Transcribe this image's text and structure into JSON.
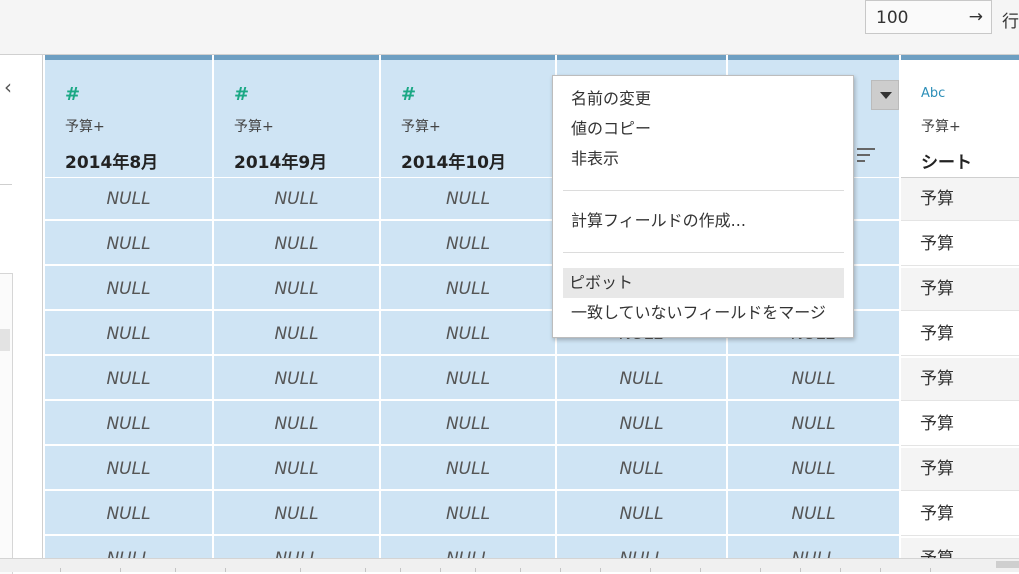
{
  "toolbar": {
    "rows_value": "100",
    "rows_arrow": "→",
    "rows_label": "行"
  },
  "left_panel": {
    "collapse_glyph": "‹"
  },
  "columns": [
    {
      "type_icon": "#",
      "source": "予算+",
      "name": "2014年8月"
    },
    {
      "type_icon": "#",
      "source": "予算+",
      "name": "2014年9月"
    },
    {
      "type_icon": "#",
      "source": "予算+",
      "name": "2014年10月"
    },
    {
      "type_icon": "#",
      "source": "",
      "name": ""
    },
    {
      "type_icon": "#",
      "source": "",
      "name": ""
    },
    {
      "type_icon": "Abc",
      "source": "予算+",
      "name": "シート"
    }
  ],
  "null_text": "NULL",
  "sheet_value": "予算",
  "context_menu": {
    "items": [
      "名前の変更",
      "値のコピー",
      "非表示",
      "計算フィールドの作成...",
      "ピボット",
      "一致していないフィールドをマージ"
    ],
    "highlighted_index": 4
  },
  "colors": {
    "selected_column": "#cfe4f4",
    "header_accent": "#6e9fc2",
    "number_icon": "#1aa884",
    "string_icon": "#2d8fb8"
  }
}
